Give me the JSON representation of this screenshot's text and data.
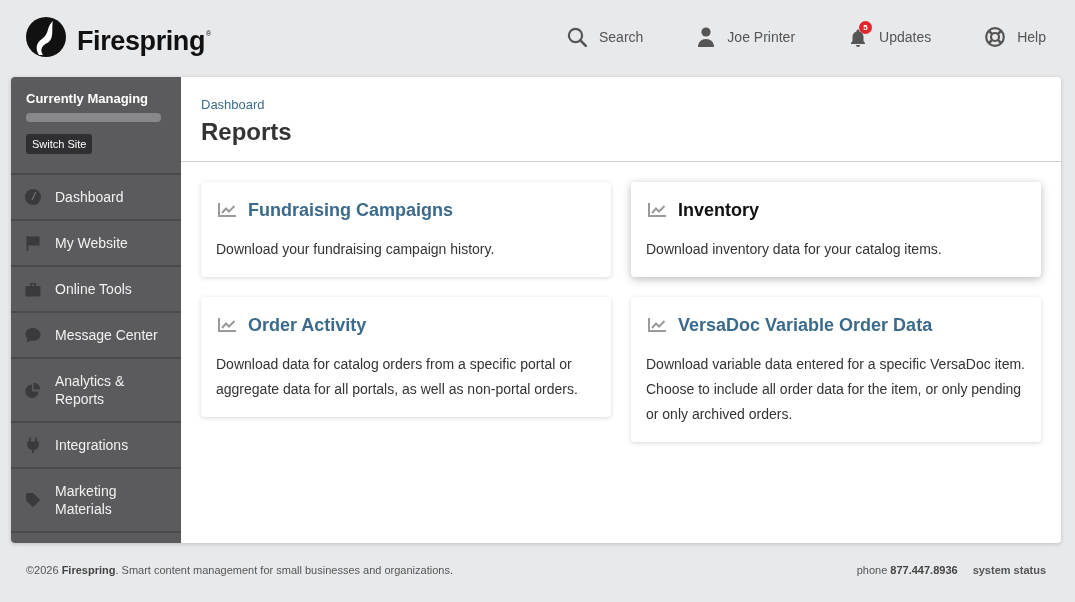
{
  "header": {
    "logo": "Firespring$^{®}$",
    "nav": [
      {
        "kind": "search",
        "label": "Search"
      },
      {
        "kind": "user",
        "label": "Joe Printer"
      },
      {
        "kind": "updates",
        "label": "Updates",
        "badge": "5"
      },
      {
        "kind": "help",
        "label": "Help"
      }
    ]
  },
  "sidebar": {
    "heading": "Currently Managing",
    "site_name_blurred": true,
    "switch_button": "Switch Site",
    "items": [
      {
        "kind": "gauge",
        "label": "Dashboard"
      },
      {
        "kind": "flag",
        "label": "My Website"
      },
      {
        "kind": "briefcase",
        "label": "Online Tools"
      },
      {
        "kind": "chat",
        "label": "Message Center"
      },
      {
        "kind": "pie",
        "label": "Analytics & Reports"
      },
      {
        "kind": "plug",
        "label": "Integrations"
      },
      {
        "kind": "tag",
        "label": "Marketing Materials"
      }
    ]
  },
  "content": {
    "breadcrumb": "Dashboard",
    "title": "Reports",
    "cards": [
      {
        "title": "Fundraising Campaigns",
        "description": "Download your fundraising campaign history.",
        "hovered": false
      },
      {
        "title": "Inventory",
        "description": "Download inventory data for your catalog items.",
        "hovered": true
      },
      {
        "title": "Order Activity",
        "description": "Download data for catalog orders from a specific portal or aggregate data for all portals, as well as non-portal orders.",
        "hovered": false
      },
      {
        "title": "VersaDoc Variable Order Data",
        "description": "Download variable data entered for a specific VersaDoc item. Choose to include all order data for the item, or only pending or only archived orders.",
        "hovered": false
      }
    ]
  },
  "footer": {
    "copyright": "©2026 **Firespring**. Smart content management for small businesses and organizations.",
    "phone": "phone **877.447.8936**",
    "status_link": "system status"
  }
}
